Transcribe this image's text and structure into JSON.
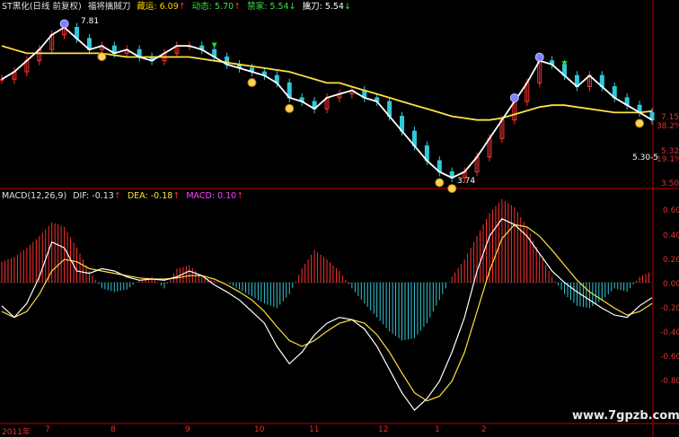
{
  "header": {
    "stock_name": "ST黑化(日线 前复权)",
    "indicator_name": "福将擒賊刀",
    "items": [
      {
        "label": "藏运",
        "value": "6.09",
        "arrow": "↑",
        "color": "#ffd000"
      },
      {
        "label": "动态",
        "value": "5.70",
        "arrow": "↑",
        "color": "#40e040"
      },
      {
        "label": "禁家",
        "value": "5.54",
        "arrow": "↓",
        "color": "#40e040"
      },
      {
        "label": "擒刀",
        "value": "5.54",
        "arrow": "↓",
        "color": "#ffffff"
      }
    ]
  },
  "macd_header": {
    "name": "MACD(12,26,9)",
    "dif_label": "DIF:",
    "dif_value": "-0.13",
    "dif_arrow": "↑",
    "dea_label": "DEA:",
    "dea_value": "-0.18",
    "dea_arrow": "↑",
    "macd_label": "MACD:",
    "macd_value": "0.10",
    "macd_arrow": "↑"
  },
  "price_axis": {
    "ticks": [
      "7.15",
      "5.32",
      "3.50"
    ],
    "pct_top": "38.2%",
    "pct_bottom": "19.1%"
  },
  "macd_axis": {
    "ticks": [
      "0.60",
      "0.40",
      "0.20",
      "0.00",
      "-0.20",
      "-0.40",
      "-0.60",
      "-0.80"
    ]
  },
  "annotations": {
    "high_left": "7.81",
    "low": "3.74",
    "right_range": "5.30-5"
  },
  "x_labels": [
    "2011年",
    "7",
    "8",
    "9",
    "10",
    "11",
    "12",
    "1",
    "2"
  ],
  "watermark": "www.7gpzb.com",
  "colors": {
    "background": "#000000",
    "up": "#ff3030",
    "down": "#30c8d8",
    "yellow_line": "#ffe040",
    "white_line": "#ffffff",
    "axis_red": "#c00000",
    "green_arrow": "#20e020"
  },
  "chart_data": [
    {
      "type": "line",
      "title": "",
      "series": [
        {
          "name": "",
          "values": [
            6.4,
            6.6,
            6.9,
            7.2,
            7.6,
            7.8,
            7.5,
            7.2,
            7.3,
            7.1,
            7.2,
            7.0,
            6.9,
            7.1,
            7.3,
            7.3,
            7.2,
            7.0,
            6.8,
            6.7,
            6.6,
            6.5,
            6.3,
            5.9,
            5.8,
            5.6,
            5.9,
            6.0,
            6.1,
            5.9,
            5.8,
            5.4,
            5.0,
            4.6,
            4.2,
            3.9,
            3.74,
            3.9,
            4.3,
            4.8,
            5.3,
            5.8,
            6.3,
            6.9,
            6.8,
            6.5,
            6.2,
            6.5,
            6.2,
            5.9,
            5.7,
            5.5,
            5.3
          ]
        },
        {
          "name": "",
          "values": [
            7.3,
            7.2,
            7.1,
            7.1,
            7.1,
            7.1,
            7.1,
            7.1,
            7.1,
            7.05,
            7.0,
            7.0,
            7.0,
            7.0,
            7.0,
            7.0,
            6.95,
            6.9,
            6.85,
            6.8,
            6.75,
            6.7,
            6.65,
            6.6,
            6.5,
            6.4,
            6.3,
            6.3,
            6.2,
            6.1,
            6.0,
            5.9,
            5.8,
            5.7,
            5.6,
            5.5,
            5.4,
            5.35,
            5.3,
            5.3,
            5.35,
            5.45,
            5.55,
            5.65,
            5.7,
            5.7,
            5.65,
            5.6,
            5.55,
            5.5,
            5.5,
            5.5,
            5.54
          ]
        }
      ],
      "ylim": [
        3.5,
        8.2
      ]
    },
    {
      "type": "bar",
      "title": "",
      "macd_values": [
        0.18,
        0.22,
        0.3,
        0.4,
        0.52,
        0.48,
        0.3,
        0.1,
        -0.05,
        -0.08,
        -0.06,
        0.02,
        0.05,
        -0.05,
        0.12,
        0.15,
        0.05,
        0.02,
        0.0,
        -0.06,
        -0.12,
        -0.18,
        -0.22,
        -0.1,
        0.12,
        0.28,
        0.2,
        0.1,
        -0.05,
        -0.18,
        -0.3,
        -0.42,
        -0.5,
        -0.48,
        -0.35,
        -0.15,
        0.05,
        0.2,
        0.4,
        0.6,
        0.72,
        0.65,
        0.48,
        0.25,
        0.05,
        -0.1,
        -0.2,
        -0.22,
        -0.15,
        -0.05,
        -0.08,
        0.05,
        0.1
      ],
      "dif": [
        -0.2,
        -0.3,
        -0.18,
        0.05,
        0.35,
        0.3,
        0.1,
        0.08,
        0.12,
        0.1,
        0.05,
        0.02,
        0.03,
        0.02,
        0.05,
        0.1,
        0.06,
        -0.02,
        -0.08,
        -0.15,
        -0.25,
        -0.35,
        -0.55,
        -0.7,
        -0.6,
        -0.45,
        -0.35,
        -0.3,
        -0.32,
        -0.4,
        -0.55,
        -0.75,
        -0.95,
        -1.1,
        -1.0,
        -0.85,
        -0.6,
        -0.3,
        0.1,
        0.4,
        0.55,
        0.5,
        0.4,
        0.25,
        0.1,
        0.0,
        -0.08,
        -0.15,
        -0.22,
        -0.28,
        -0.3,
        -0.2,
        -0.13
      ],
      "dea": [
        -0.25,
        -0.3,
        -0.25,
        -0.1,
        0.1,
        0.2,
        0.18,
        0.12,
        0.1,
        0.08,
        0.06,
        0.04,
        0.03,
        0.03,
        0.04,
        0.06,
        0.06,
        0.03,
        -0.02,
        -0.08,
        -0.15,
        -0.25,
        -0.38,
        -0.5,
        -0.55,
        -0.5,
        -0.42,
        -0.35,
        -0.32,
        -0.35,
        -0.45,
        -0.6,
        -0.78,
        -0.95,
        -1.02,
        -0.98,
        -0.85,
        -0.6,
        -0.25,
        0.1,
        0.38,
        0.5,
        0.48,
        0.4,
        0.28,
        0.15,
        0.02,
        -0.08,
        -0.15,
        -0.22,
        -0.28,
        -0.25,
        -0.18
      ],
      "ylim": [
        -1.2,
        0.75
      ]
    }
  ]
}
